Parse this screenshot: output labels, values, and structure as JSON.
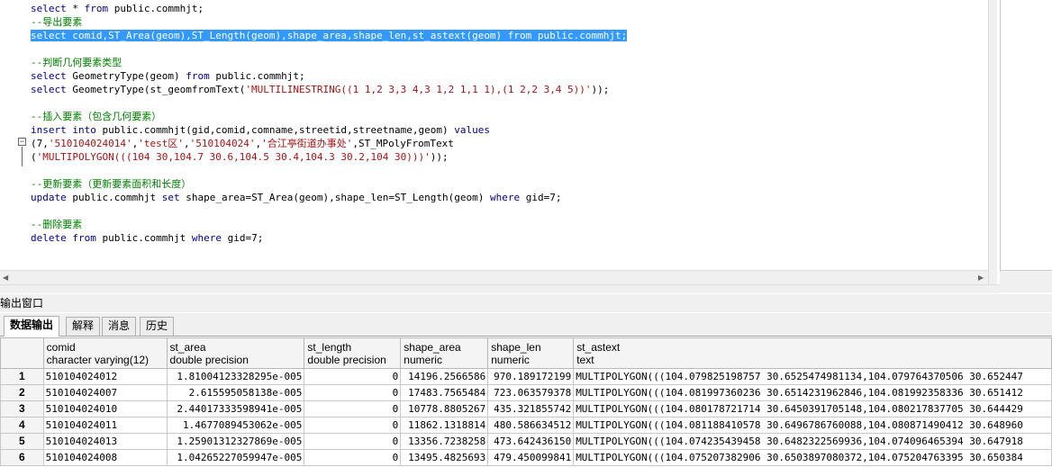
{
  "editor": {
    "lines": [
      {
        "parts": [
          {
            "c": "kw",
            "t": "select"
          },
          {
            "c": "fn",
            "t": " * "
          },
          {
            "c": "kw",
            "t": "from"
          },
          {
            "c": "fn",
            "t": " public.commhjt;"
          }
        ]
      },
      {
        "parts": [
          {
            "c": "cm",
            "t": "--导出要素"
          }
        ]
      },
      {
        "parts": [
          {
            "c": "sel",
            "t": "select comid,ST_Area(geom),ST_Length(geom),shape_area,shape_len,st_astext(geom) from public.commhjt;"
          }
        ]
      },
      {
        "parts": []
      },
      {
        "parts": [
          {
            "c": "cm",
            "t": "--判断几何要素类型"
          }
        ]
      },
      {
        "parts": [
          {
            "c": "kw",
            "t": "select"
          },
          {
            "c": "fn",
            "t": " GeometryType(geom) "
          },
          {
            "c": "kw",
            "t": "from"
          },
          {
            "c": "fn",
            "t": " public.commhjt;"
          }
        ]
      },
      {
        "parts": [
          {
            "c": "kw",
            "t": "select"
          },
          {
            "c": "fn",
            "t": " GeometryType(st_geomfromText("
          },
          {
            "c": "st",
            "t": "'MULTILINESTRING((1 1,2 3,3 4,3 1,2 1,1 1),(1 2,2 3,4 5))'"
          },
          {
            "c": "fn",
            "t": "));"
          }
        ]
      },
      {
        "parts": []
      },
      {
        "parts": [
          {
            "c": "cm",
            "t": "--插入要素（包含几何要素）"
          }
        ]
      },
      {
        "parts": [
          {
            "c": "kw",
            "t": "insert into"
          },
          {
            "c": "fn",
            "t": " public.commhjt(gid,comid,comname,streetid,streetname,geom) "
          },
          {
            "c": "kw",
            "t": "values"
          }
        ]
      },
      {
        "parts": [
          {
            "c": "fn",
            "t": "(7,"
          },
          {
            "c": "st",
            "t": "'510104024014'"
          },
          {
            "c": "fn",
            "t": ","
          },
          {
            "c": "st",
            "t": "'test区'"
          },
          {
            "c": "fn",
            "t": ","
          },
          {
            "c": "st",
            "t": "'510104024'"
          },
          {
            "c": "fn",
            "t": ","
          },
          {
            "c": "st",
            "t": "'合江亭街道办事处'"
          },
          {
            "c": "fn",
            "t": ",ST_MPolyFromText"
          }
        ]
      },
      {
        "parts": [
          {
            "c": "fn",
            "t": "("
          },
          {
            "c": "st",
            "t": "'MULTIPOLYGON(((104 30,104.7 30.6,104.5 30.4,104.3 30.2,104 30)))'"
          },
          {
            "c": "fn",
            "t": "));"
          }
        ]
      },
      {
        "parts": []
      },
      {
        "parts": [
          {
            "c": "cm",
            "t": "--更新要素（更新要素面积和长度）"
          }
        ]
      },
      {
        "parts": [
          {
            "c": "kw",
            "t": "update"
          },
          {
            "c": "fn",
            "t": " public.commhjt "
          },
          {
            "c": "kw",
            "t": "set"
          },
          {
            "c": "fn",
            "t": " shape_area=ST_Area(geom),shape_len=ST_Length(geom) "
          },
          {
            "c": "kw",
            "t": "where"
          },
          {
            "c": "fn",
            "t": " gid=7;"
          }
        ]
      },
      {
        "parts": []
      },
      {
        "parts": [
          {
            "c": "cm",
            "t": "--删除要素"
          }
        ]
      },
      {
        "parts": [
          {
            "c": "kw",
            "t": "delete from"
          },
          {
            "c": "fn",
            "t": " public.commhjt "
          },
          {
            "c": "kw",
            "t": "where"
          },
          {
            "c": "fn",
            "t": " gid=7;"
          }
        ]
      }
    ],
    "fold_icon": "minus",
    "scroll_left_glyph": "◀",
    "scroll_right_glyph": "▶"
  },
  "output": {
    "title": "输出窗口",
    "tabs": [
      "数据输出",
      "解释",
      "消息",
      "历史"
    ],
    "active_tab": 0
  },
  "grid": {
    "columns": [
      {
        "name": "comid",
        "type": "character varying(12)"
      },
      {
        "name": "st_area",
        "type": "double precision"
      },
      {
        "name": "st_length",
        "type": "double precision"
      },
      {
        "name": "shape_area",
        "type": "numeric"
      },
      {
        "name": "shape_len",
        "type": "numeric"
      },
      {
        "name": "st_astext",
        "type": "text"
      }
    ],
    "rows": [
      [
        "1",
        "510104024012",
        "1.81004123328295e-005",
        "0",
        "14196.2566586",
        "970.189172199",
        "MULTIPOLYGON(((104.079825198757 30.6525474981134,104.079764370506 30.652447"
      ],
      [
        "2",
        "510104024007",
        "2.615595058138e-005",
        "0",
        "17483.7565484",
        "723.063579378",
        "MULTIPOLYGON(((104.081997360236 30.6514231962846,104.081992358336 30.651412"
      ],
      [
        "3",
        "510104024010",
        "2.44017333598941e-005",
        "0",
        "10778.8805267",
        "435.321855742",
        "MULTIPOLYGON(((104.080178721714 30.6450391705148,104.080217837705 30.644429"
      ],
      [
        "4",
        "510104024011",
        "1.4677089453062e-005",
        "0",
        "11862.1318814",
        "480.586634512",
        "MULTIPOLYGON(((104.081188410578 30.6496786760088,104.080871490412 30.648960"
      ],
      [
        "5",
        "510104024013",
        "1.25901312327869e-005",
        "0",
        "13356.7238258",
        "473.642436150",
        "MULTIPOLYGON(((104.074235439458 30.6482322569936,104.074096465394 30.647918"
      ],
      [
        "6",
        "510104024008",
        "1.04265227059947e-005",
        "0",
        "13495.4825693",
        "479.450099841",
        "MULTIPOLYGON(((104.075207382906 30.6503897080372,104.075204763395 30.650384"
      ]
    ]
  }
}
